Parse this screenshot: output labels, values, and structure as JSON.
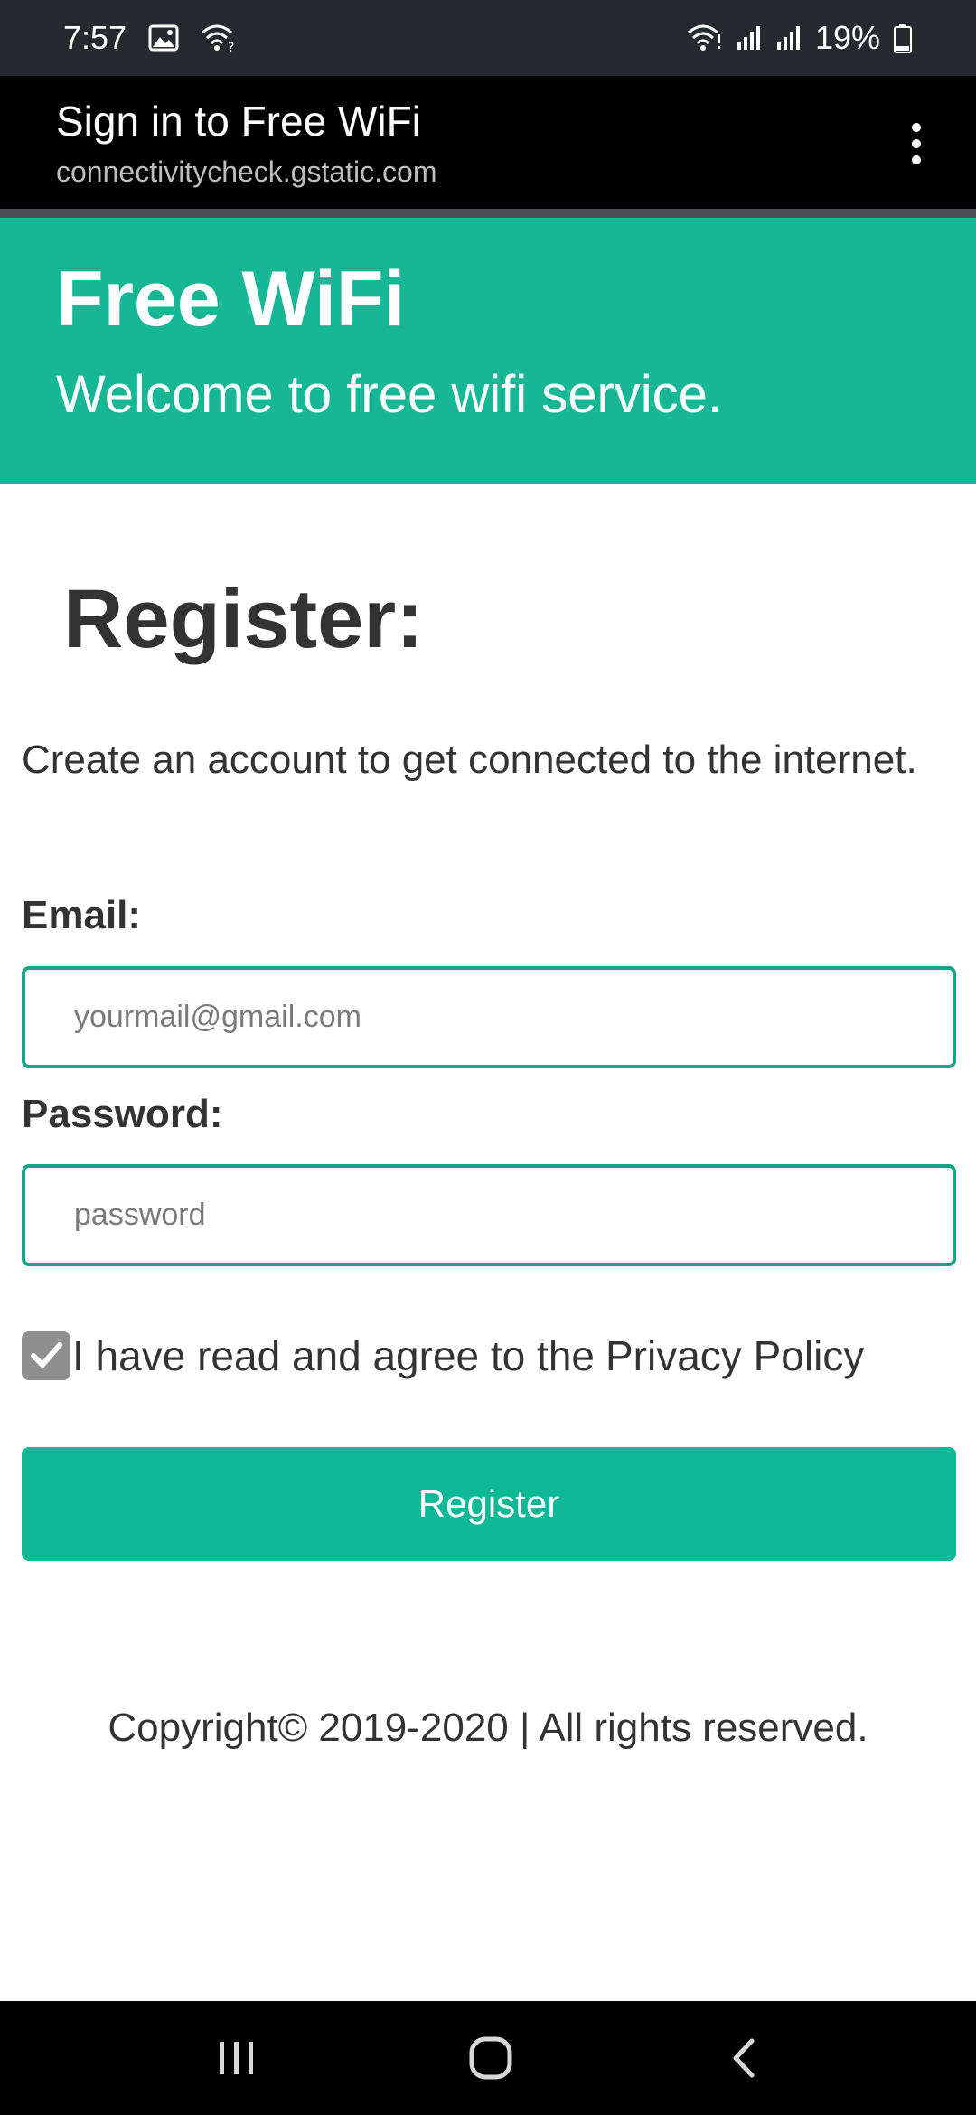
{
  "status_bar": {
    "time": "7:57",
    "battery_percent": "19%",
    "icons": [
      "image-icon",
      "wifi-question-icon",
      "wifi-icon",
      "signal-icon",
      "signal-icon",
      "battery-icon"
    ]
  },
  "app_bar": {
    "title": "Sign in to Free WiFi",
    "url": "connectivitycheck.gstatic.com",
    "menu_icon": "more-vert-icon"
  },
  "banner": {
    "title": "Free WiFi",
    "subtitle": "Welcome to free wifi service."
  },
  "form": {
    "heading": "Register:",
    "intro": "Create an account to get connected to the internet.",
    "email_label": "Email:",
    "email_placeholder": "yourmail@gmail.com",
    "email_value": "",
    "password_label": "Password:",
    "password_placeholder": "password",
    "password_value": "",
    "agree_text": "I have read and agree to the ",
    "privacy_link": "Privacy Policy",
    "agree_checked": true,
    "submit_label": "Register"
  },
  "footer": {
    "copyright": "Copyright© 2019-2020 | All rights reserved."
  },
  "colors": {
    "accent": "#17b796",
    "button": "#0db896",
    "input_border": "#17a58a",
    "text": "#333333"
  },
  "nav_bar": {
    "buttons": [
      "recents-icon",
      "home-icon",
      "back-icon"
    ]
  }
}
